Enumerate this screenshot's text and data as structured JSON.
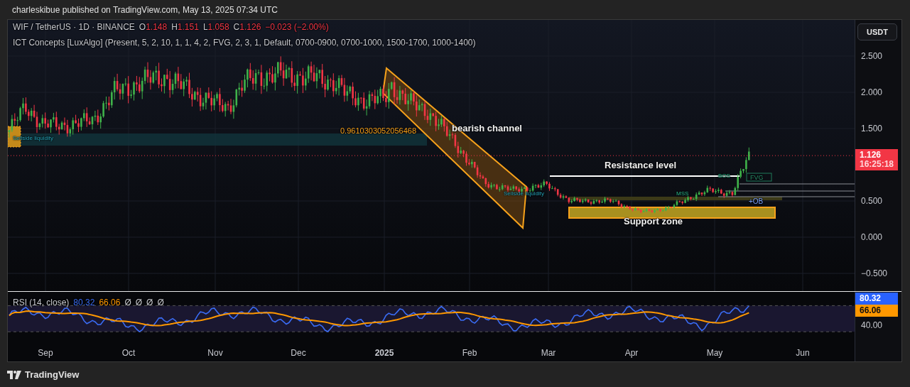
{
  "header": {
    "text": "charleskibue published on TradingView.com, May 13, 2025 07:34 UTC"
  },
  "legend": {
    "symbol": "WIF / TetherUS · 1D · BINANCE",
    "ohlc": [
      {
        "label": "O",
        "value": "1.148"
      },
      {
        "label": "H",
        "value": "1.151"
      },
      {
        "label": "L",
        "value": "1.058"
      },
      {
        "label": "C",
        "value": "1.126"
      }
    ],
    "change": "−0.023 (−2.00%)",
    "indicator": "ICT Concepts [LuxAlgo] (Present, 5, 2, 10, 1, 1, 4, 2, FVG, 2, 3, 1, Default, 0700-0900, 0700-1000, 1500-1700, 1000-1400)"
  },
  "annotations": [
    {
      "kind": "level",
      "text": "0.9610303052056468"
    },
    {
      "kind": "title",
      "text": "bearish channel"
    },
    {
      "kind": "title",
      "text": "Resistance level"
    },
    {
      "kind": "title",
      "text": "Support zone"
    },
    {
      "kind": "liquidity",
      "text": "Sellside liquidity"
    },
    {
      "kind": "liquidity",
      "text": "Sellside liquidity"
    },
    {
      "kind": "structure",
      "text": "MSS"
    },
    {
      "kind": "structure",
      "text": "BOS"
    },
    {
      "kind": "gap",
      "text": "FVG"
    },
    {
      "kind": "block",
      "text": "+OB"
    }
  ],
  "price_axis": {
    "currency": "USDT",
    "ticks": [
      "2.500",
      "2.000",
      "1.500",
      "0.500",
      "0.000",
      "−0.500"
    ],
    "last_price": "1.126",
    "countdown": "16:25:18"
  },
  "rsi": {
    "title": "RSI (14, close)",
    "value": "80.32",
    "ma": "66.06",
    "extra": [
      "Ø",
      "Ø",
      "Ø",
      "Ø"
    ],
    "axis_tick": "40.00",
    "value_tag": "80.32",
    "ma_tag": "66.06"
  },
  "time_axis": [
    {
      "label": "Sep",
      "major": false
    },
    {
      "label": "Oct",
      "major": false
    },
    {
      "label": "Nov",
      "major": false
    },
    {
      "label": "Dec",
      "major": false
    },
    {
      "label": "2025",
      "major": true
    },
    {
      "label": "Feb",
      "major": false
    },
    {
      "label": "Mar",
      "major": false
    },
    {
      "label": "Apr",
      "major": false
    },
    {
      "label": "May",
      "major": false
    },
    {
      "label": "Jun",
      "major": false
    }
  ],
  "footer": {
    "logo_text": "TradingView"
  }
}
